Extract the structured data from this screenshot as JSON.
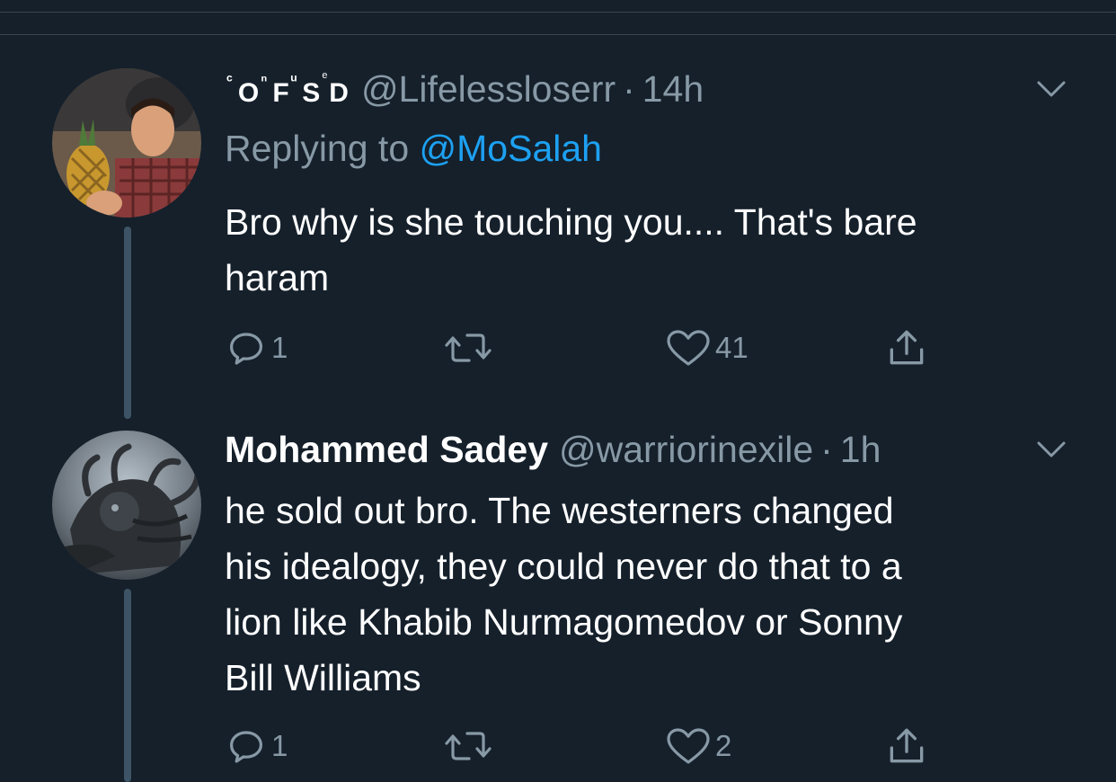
{
  "tweets": [
    {
      "author_display_name": "ᶜOⁿFᵘSᵉD",
      "name_parts": [
        "ᶜ",
        "O",
        "ⁿ",
        "F",
        "ᵘ",
        "S",
        "ᵉ",
        "D"
      ],
      "handle": "@Lifelessloserr",
      "separator": "·",
      "time": "14h",
      "replying_prefix": "Replying to",
      "replying_to": "@MoSalah",
      "text_lines": [
        "Bro why is she touching you.... That's bare",
        "haram"
      ],
      "reply_count": "1",
      "retweet_count": "",
      "like_count": "41",
      "avatar_icon": "avatar-icon",
      "menu_icon": "chevron-down-icon"
    },
    {
      "author_display_name": "Mohammed Sadey",
      "handle": "@warriorinexile",
      "separator": "·",
      "time": "1h",
      "text_lines": [
        "he sold out bro. The westerners changed",
        "his idealogy, they could never do that to a",
        "lion like Khabib Nurmagomedov or Sonny",
        "Bill Williams"
      ],
      "reply_count": "1",
      "retweet_count": "",
      "like_count": "2",
      "avatar_icon": "avatar-icon",
      "menu_icon": "chevron-down-icon"
    }
  ],
  "colors": {
    "background": "#15202b",
    "secondary_text": "#8899a6",
    "mention": "#1da1f2",
    "thread_line": "#3d5466",
    "divider": "#38444d"
  },
  "icons": [
    "reply-icon",
    "retweet-icon",
    "like-icon",
    "share-icon",
    "chevron-down-icon"
  ]
}
